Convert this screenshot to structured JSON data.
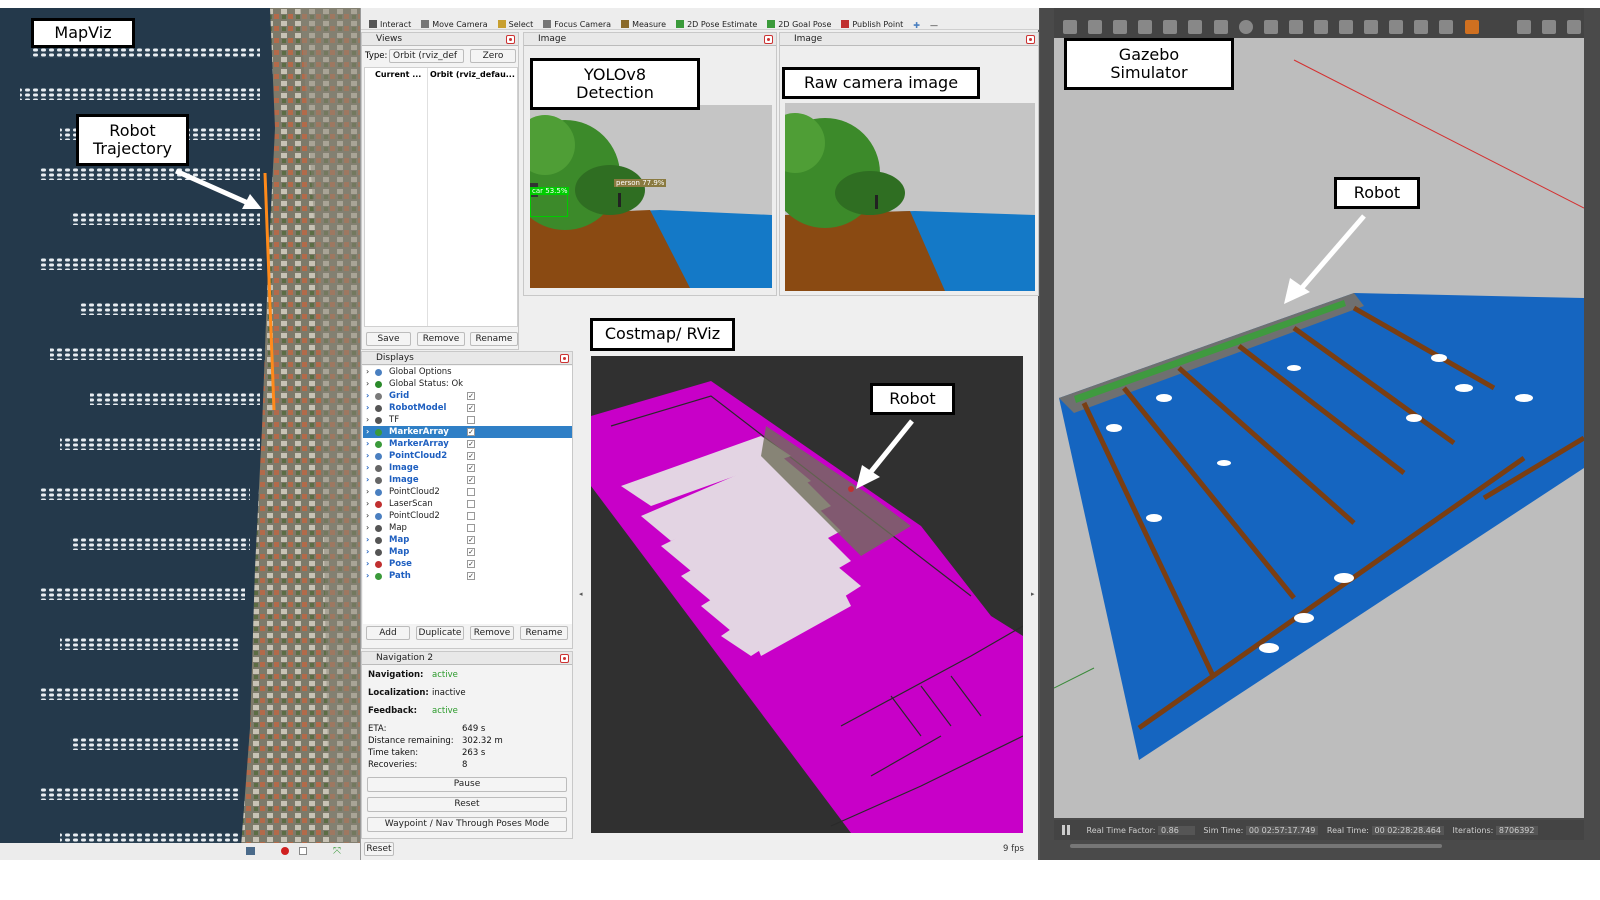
{
  "callouts": {
    "mapviz": "MapViz",
    "trajectory": "Robot\nTrajectory",
    "yolo": "YOLOv8\nDetection",
    "raw": "Raw camera image",
    "costmap": "Costmap/ RViz",
    "robot_costmap": "Robot",
    "gazebo": "Gazebo\nSimulator",
    "robot_gazebo": "Robot"
  },
  "toolbar": {
    "items": [
      "Interact",
      "Move Camera",
      "Select",
      "Focus Camera",
      "Measure",
      "2D Pose Estimate",
      "2D Goal Pose",
      "Publish Point"
    ]
  },
  "views": {
    "title": "Views",
    "type_label": "Type:",
    "type_value": "Orbit (rviz_def",
    "zero": "Zero",
    "current_label": "Current ...",
    "current_value": "Orbit (rviz_defau...",
    "save": "Save",
    "remove": "Remove",
    "rename": "Rename"
  },
  "image_panels": [
    "Image",
    "Image"
  ],
  "detections": {
    "car": "car 53.5%",
    "person": "person 77.9%"
  },
  "displays": {
    "title": "Displays",
    "items": [
      {
        "label": "Global Options",
        "checked": null,
        "color": "#4a7fc0"
      },
      {
        "label": "Global Status: Ok",
        "checked": null,
        "color": "#2a8a2a"
      },
      {
        "label": "Grid",
        "checked": true,
        "color": "#7a7a7a"
      },
      {
        "label": "RobotModel",
        "checked": true,
        "color": "#555555"
      },
      {
        "label": "TF",
        "checked": false,
        "color": "#555555"
      },
      {
        "label": "MarkerArray",
        "checked": true,
        "color": "#3a9a3a"
      },
      {
        "label": "MarkerArray",
        "checked": true,
        "color": "#3a9a3a"
      },
      {
        "label": "PointCloud2",
        "checked": true,
        "color": "#4a7fc0"
      },
      {
        "label": "Image",
        "checked": true,
        "color": "#666666"
      },
      {
        "label": "Image",
        "checked": true,
        "color": "#666666"
      },
      {
        "label": "PointCloud2",
        "checked": false,
        "color": "#4a7fc0"
      },
      {
        "label": "LaserScan",
        "checked": false,
        "color": "#c03030"
      },
      {
        "label": "PointCloud2",
        "checked": false,
        "color": "#4a7fc0"
      },
      {
        "label": "Map",
        "checked": false,
        "color": "#555555"
      },
      {
        "label": "Map",
        "checked": true,
        "color": "#555555"
      },
      {
        "label": "Map",
        "checked": true,
        "color": "#555555"
      },
      {
        "label": "Pose",
        "checked": true,
        "color": "#c03030"
      },
      {
        "label": "Path",
        "checked": true,
        "color": "#3a9a3a"
      }
    ],
    "add": "Add",
    "duplicate": "Duplicate",
    "remove": "Remove",
    "rename": "Rename"
  },
  "nav2": {
    "title": "Navigation 2",
    "navigation_label": "Navigation:",
    "navigation_value": "active",
    "localization_label": "Localization:",
    "localization_value": "inactive",
    "feedback_label": "Feedback:",
    "feedback_value": "active",
    "eta_label": "ETA:",
    "eta_value": "649 s",
    "distance_label": "Distance remaining:",
    "distance_value": "302.32 m",
    "time_label": "Time taken:",
    "time_value": "263 s",
    "recoveries_label": "Recoveries:",
    "recoveries_value": "8",
    "pause": "Pause",
    "reset": "Reset",
    "waypoint": "Waypoint / Nav Through Poses Mode"
  },
  "footer": {
    "reset": "Reset",
    "fps": "9 fps"
  },
  "gazebo_status": {
    "rtf_label": "Real Time Factor:",
    "rtf_value": "0.86",
    "sim_label": "Sim Time:",
    "sim_value": "00 02:57:17.749",
    "real_label": "Real Time:",
    "real_value": "00 02:28:28.464",
    "iter_label": "Iterations:",
    "iter_value": "8706392"
  },
  "colors": {
    "costmap": "#c800c8",
    "water": "#1565c0",
    "dock": "#7a3e12",
    "trajectory": "#ff8a1a",
    "selection": "#2f7fc6"
  }
}
